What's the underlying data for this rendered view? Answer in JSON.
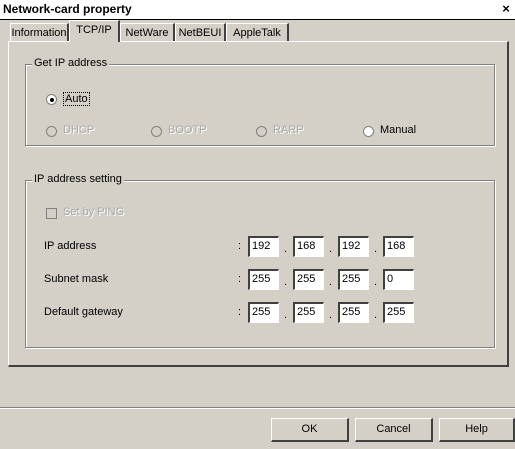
{
  "window": {
    "title": "Network-card property",
    "close_glyph": "×"
  },
  "tabs": [
    {
      "label": "Information",
      "active": false
    },
    {
      "label": "TCP/IP",
      "active": true
    },
    {
      "label": "NetWare",
      "active": false
    },
    {
      "label": "NetBEUI",
      "active": false
    },
    {
      "label": "AppleTalk",
      "active": false
    }
  ],
  "get_ip": {
    "legend": "Get IP address",
    "auto": {
      "label": "Auto",
      "selected": true
    },
    "options": [
      {
        "label": "DHCP",
        "enabled": false
      },
      {
        "label": "BOOTP",
        "enabled": false
      },
      {
        "label": "RARP",
        "enabled": false
      },
      {
        "label": "Manual",
        "enabled": true
      }
    ]
  },
  "ip_setting": {
    "legend": "IP address setting",
    "ping_label": "Set by PING",
    "colon": ":",
    "dot": ".",
    "rows": [
      {
        "label": "IP address",
        "octets": [
          "192",
          "168",
          "192",
          "168"
        ]
      },
      {
        "label": "Subnet mask",
        "octets": [
          "255",
          "255",
          "255",
          "0"
        ]
      },
      {
        "label": "Default gateway",
        "octets": [
          "255",
          "255",
          "255",
          "255"
        ]
      }
    ]
  },
  "buttons": {
    "ok": "OK",
    "cancel": "Cancel",
    "help": "Help"
  }
}
